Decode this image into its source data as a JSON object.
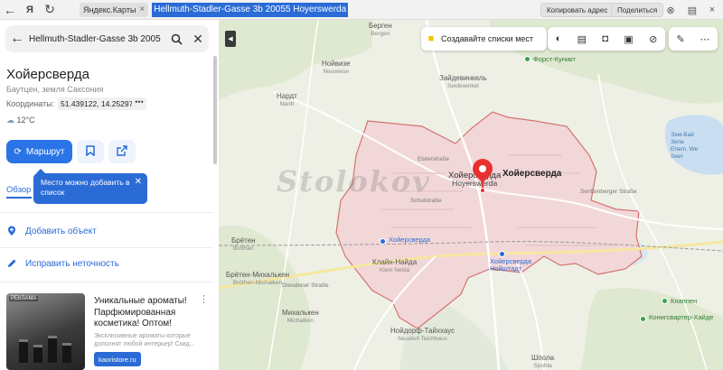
{
  "browser": {
    "tab_label": "Яндекс.Карты",
    "url": "Hellmuth-Stadler-Gasse 3b 20055 Hoyerswerda",
    "copy_address_label": "Копировать адрес",
    "share_label": "Поделиться"
  },
  "panel": {
    "search_value": "Hellmuth-Stadler-Gasse 3b 2005",
    "title": "Хойерсверда",
    "subtitle": "Баутцен, земля Саксония",
    "coords_label": "Координаты:",
    "coords_value": "51.439122, 14.252976",
    "coords_more": "•••",
    "weather": "12°C",
    "route_label": "Маршрут",
    "tooltip_text": "Место можно добавить в список",
    "tab_overview": "Обзор",
    "add_object_label": "Добавить объект",
    "fix_inaccuracy_label": "Исправить неточность",
    "ad": {
      "tag": "РЕКЛАМА",
      "title": "Уникальные ароматы! Парфюмированная косметика! Оптом!",
      "description": "Эксклюзивные ароматы которые дополнят любой интерьер! Скид...",
      "link": "kaoristore.ru"
    }
  },
  "map": {
    "toolbar_create_list": "Создавайте списки мест",
    "city_label": "Хойерсверда",
    "city_name_ru": "Хойерсверда",
    "city_name_de": "Hoyerswerda",
    "watermark": "Stolokov",
    "labels": [
      {
        "ru": "Берген",
        "de": "Bergen"
      },
      {
        "ru": "Нойвизе",
        "de": "Neuwiese"
      },
      {
        "ru": "Зайдевинкель",
        "de": "Seidewinkel"
      },
      {
        "ru": "Нардт",
        "de": "Nardt"
      },
      {
        "ru": "Брётен",
        "de": "Bröthen"
      },
      {
        "ru": "Брётен-Михалькен",
        "de": "Bröthen-Michalken"
      },
      {
        "ru": "Михалькен",
        "de": "Michalken"
      },
      {
        "ru": "Клайн-Найда",
        "de": "Klein Neida"
      },
      {
        "ru": "Нойдорф-Тайххаус",
        "de": "Neudorf-Teichhaus"
      },
      {
        "ru": "Шпола",
        "de": "Spohla"
      }
    ],
    "streets": [
      "Elsterstraße",
      "Schulstraße",
      "Dresdener Straße",
      "Senftenberger Straße"
    ],
    "stations": [
      "Хойерсверда",
      "Хойерсверда Нойштадт"
    ],
    "pois": [
      "Форст-Куникт",
      "Кнаппен",
      "Конигсвартер-Хайде"
    ],
    "lake": [
      "Эзм-Вай",
      "Зепа",
      "Ehem. We",
      "Seer"
    ]
  }
}
